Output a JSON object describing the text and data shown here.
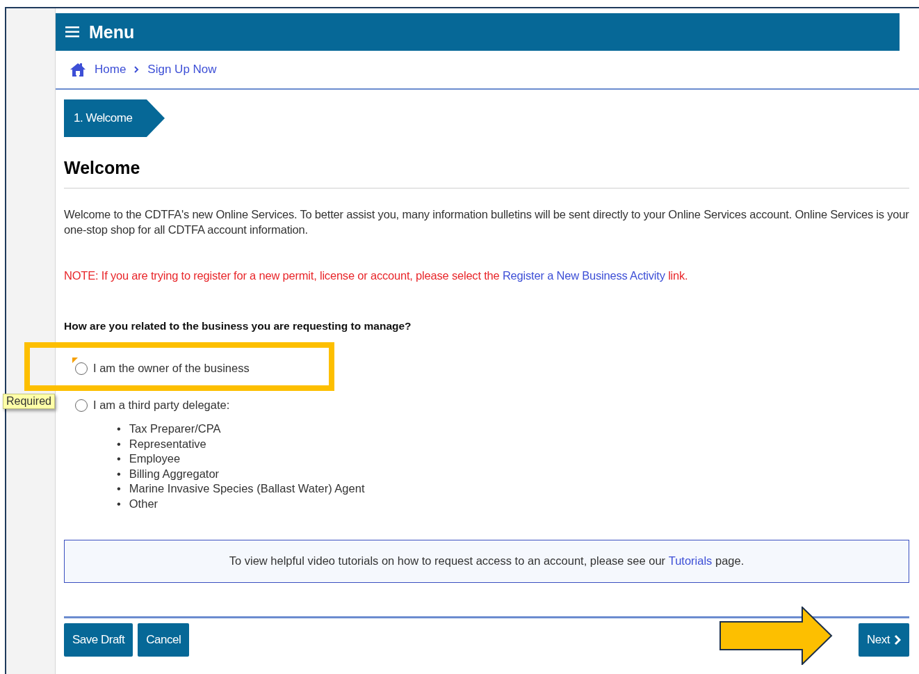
{
  "header": {
    "menu_label": "Menu"
  },
  "breadcrumbs": [
    {
      "label": "Home",
      "kind": "home"
    },
    {
      "label": "Sign Up Now",
      "kind": "page"
    }
  ],
  "steps": [
    {
      "label": "1. Welcome",
      "selected": true
    }
  ],
  "title": "Welcome",
  "intro": "Welcome to the CDTFA's new Online Services. To better assist you, many information bulletins will be sent directly to your Online Services account. Online Services is your one-stop shop for all CDTFA account information.",
  "note": {
    "text": "NOTE: If you are trying to register for a new permit, license or account, please select the",
    "link": "Register a New Business Activity",
    "after": "link."
  },
  "question": "How are you related to the business you are requesting to manage?",
  "tooltip": "Required",
  "options": [
    {
      "label": "I am the owner of the business",
      "selected": false,
      "highlighted": true
    },
    {
      "label": "I am a third party delegate:",
      "selected": false,
      "highlighted": false
    }
  ],
  "list_marker": "•",
  "delegate_types": [
    "Tax Preparer/CPA",
    "Representative",
    "Employee",
    "Billing Aggregator",
    "Marine Invasive Species (Ballast Water) Agent",
    "Other"
  ],
  "info": {
    "before": "To view helpful video tutorials on how to request access to an account, please see our",
    "link": "Tutorials",
    "after": "page."
  },
  "buttons": [
    {
      "label": "Save Draft",
      "kind": "left"
    },
    {
      "label": "Cancel",
      "kind": "left"
    },
    {
      "label": "Next",
      "kind": "next"
    }
  ]
}
